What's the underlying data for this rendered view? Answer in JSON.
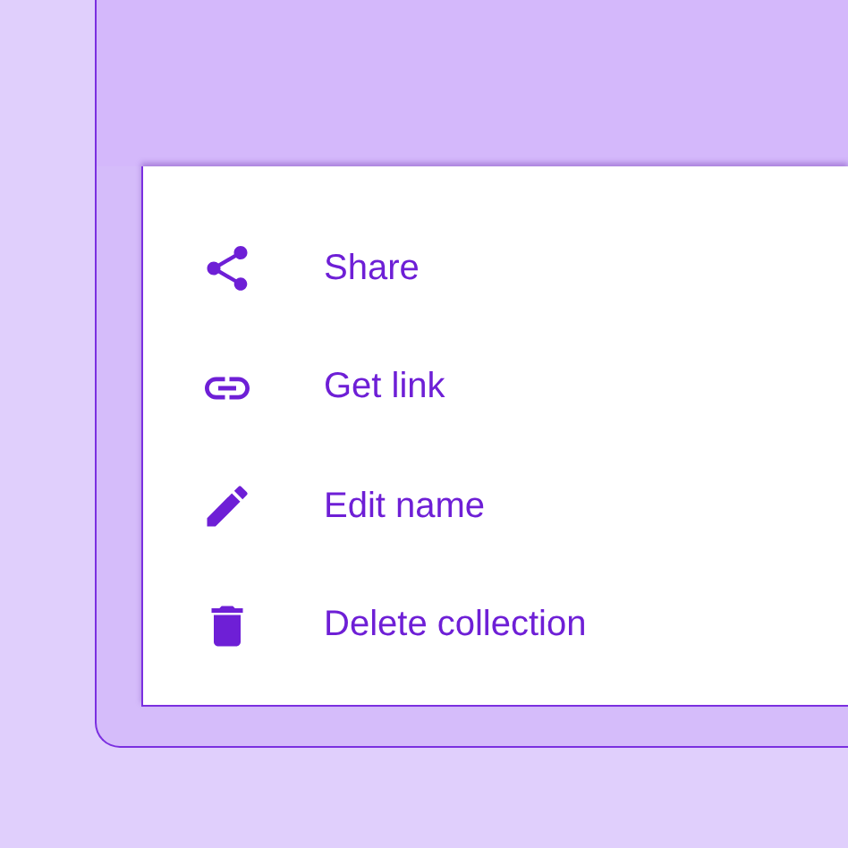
{
  "menu": {
    "items": [
      {
        "label": "Share",
        "kind": "share"
      },
      {
        "label": "Get link",
        "kind": "link"
      },
      {
        "label": "Edit name",
        "kind": "edit"
      },
      {
        "label": "Delete collection",
        "kind": "delete"
      }
    ]
  }
}
